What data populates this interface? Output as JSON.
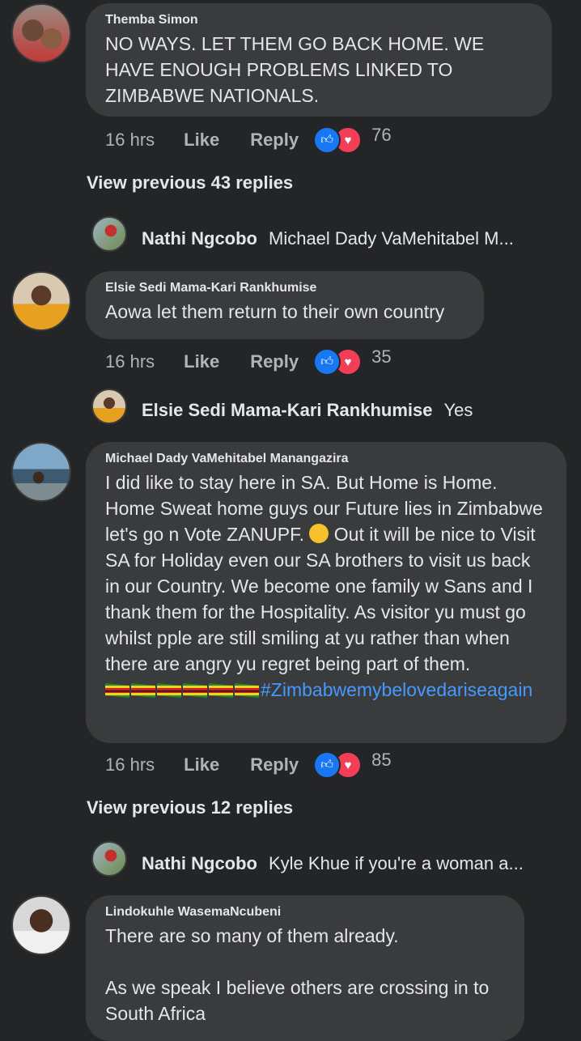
{
  "comments": [
    {
      "author": "Themba Simon",
      "text": "NO WAYS. LET THEM GO BACK HOME. WE HAVE ENOUGH PROBLEMS LINKED TO ZIMBABWE NATIONALS.",
      "time": "16 hrs",
      "like": "Like",
      "reply": "Reply",
      "reactions": "76"
    },
    {
      "author": "Elsie Sedi Mama-Kari Rankhumise",
      "text": "Aowa let them return to their own country",
      "time": "16 hrs",
      "like": "Like",
      "reply": "Reply",
      "reactions": "35"
    },
    {
      "author": "Michael Dady VaMehitabel Manangazira",
      "text": "I did like to stay here in SA. But Home is Home. Home Sweat home guys our Future lies in Zimbabwe let's go n Vote ZANUPF.",
      "text_cont": " Out it will be nice to Visit SA for Holiday even our SA brothers to visit us back in our Country. We become one family w Sans and  I thank them for the Hospitality. As visitor yu must go whilst pple are still smiling at yu rather than when there are angry yu regret being part of them.",
      "hashtag": "#Zimbabwemybelovedariseagain",
      "time": "16 hrs",
      "like": "Like",
      "reply": "Reply",
      "reactions": "85"
    },
    {
      "author": "Lindokuhle WasemaNcubeni",
      "text": "There are so many of them already.\n\nAs we speak I believe others are crossing in to South Africa"
    }
  ],
  "view_prev_1": "View previous 43 replies",
  "view_prev_2": "View previous 12 replies",
  "replies": [
    {
      "name": "Nathi Ngcobo",
      "snippet": "Michael Dady VaMehitabel M..."
    },
    {
      "name": "Elsie Sedi Mama-Kari Rankhumise",
      "snippet": "Yes"
    },
    {
      "name": "Nathi Ngcobo",
      "snippet": "Kyle Khue if you're a woman a..."
    }
  ],
  "colors": {
    "background": "#242526",
    "bubble": "#3a3b3c",
    "like": "#1877f2",
    "love": "#f33e58",
    "hashtag": "#4599ff"
  }
}
